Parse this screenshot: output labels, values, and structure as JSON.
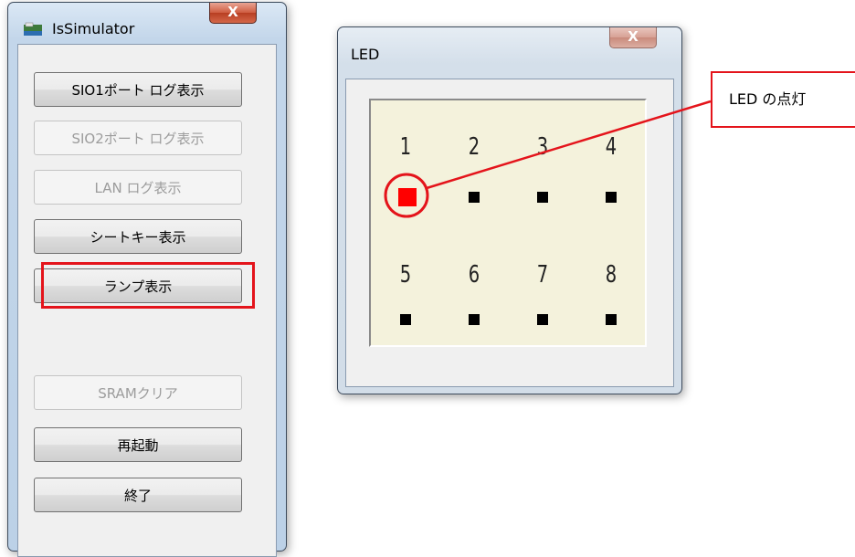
{
  "simulator_window": {
    "title": "IsSimulator",
    "close_label": "X",
    "buttons": {
      "sio1_log": "SIO1ポート ログ表示",
      "sio2_log": "SIO2ポート ログ表示",
      "lan_log": "LAN ログ表示",
      "sheet_key": "シートキー表示",
      "lamp": "ランプ表示",
      "sram_clear": "SRAMクリア",
      "restart": "再起動",
      "exit": "終了"
    },
    "disabled_buttons": [
      "sio2_log",
      "lan_log",
      "sram_clear"
    ],
    "highlighted_button": "lamp"
  },
  "led_window": {
    "title": "LED",
    "close_label": "X",
    "leds": [
      {
        "label": "1",
        "lit": true
      },
      {
        "label": "2",
        "lit": false
      },
      {
        "label": "3",
        "lit": false
      },
      {
        "label": "4",
        "lit": false
      },
      {
        "label": "5",
        "lit": false
      },
      {
        "label": "6",
        "lit": false
      },
      {
        "label": "7",
        "lit": false
      },
      {
        "label": "8",
        "lit": false
      }
    ],
    "lit_color": "#ff0000",
    "off_color": "#000000",
    "panel_color": "#f4f2dc"
  },
  "callout": {
    "text": "LED の点灯",
    "color": "#e4141b"
  }
}
